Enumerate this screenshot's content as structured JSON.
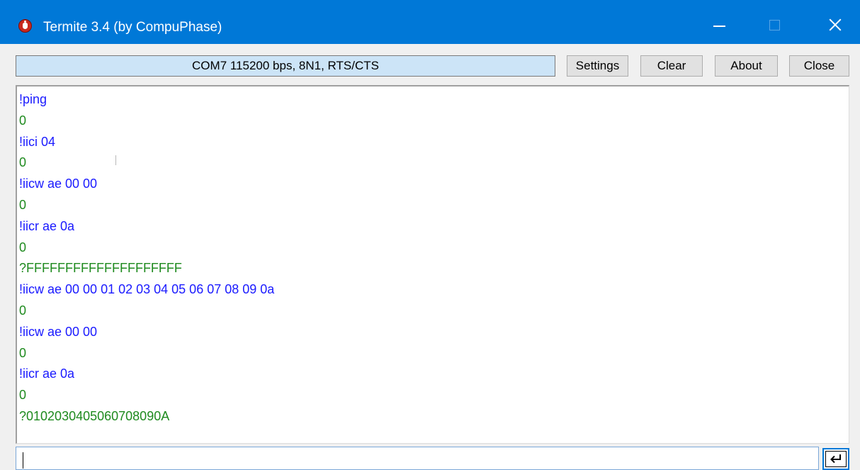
{
  "window": {
    "title": "Termite 3.4 (by CompuPhase)"
  },
  "toolbar": {
    "status": "COM7 115200 bps, 8N1, RTS/CTS",
    "settings_label": "Settings",
    "clear_label": "Clear",
    "about_label": "About",
    "close_label": "Close"
  },
  "terminal": {
    "lines": [
      {
        "text": "!ping",
        "kind": "tx"
      },
      {
        "text": "0",
        "kind": "rx"
      },
      {
        "text": "!iici 04",
        "kind": "tx"
      },
      {
        "text": "0",
        "kind": "rx"
      },
      {
        "text": "!iicw ae 00 00",
        "kind": "tx"
      },
      {
        "text": "0",
        "kind": "rx"
      },
      {
        "text": "!iicr ae 0a",
        "kind": "tx"
      },
      {
        "text": "0",
        "kind": "rx"
      },
      {
        "text": "?FFFFFFFFFFFFFFFFFFFF",
        "kind": "rx"
      },
      {
        "text": "!iicw ae 00 00 01 02 03 04 05 06 07 08 09 0a",
        "kind": "tx"
      },
      {
        "text": "0",
        "kind": "rx"
      },
      {
        "text": "!iicw ae 00 00",
        "kind": "tx"
      },
      {
        "text": "0",
        "kind": "rx"
      },
      {
        "text": "!iicr ae 0a",
        "kind": "tx"
      },
      {
        "text": "0",
        "kind": "rx"
      },
      {
        "text": "?0102030405060708090A",
        "kind": "rx"
      }
    ]
  },
  "input": {
    "value": ""
  },
  "colors": {
    "titlebar": "#0078d7",
    "status_background": "#cce4f7",
    "sent_text": "#1a1aff",
    "received_text": "#1e8a1e"
  },
  "icons": {
    "app": "termite-bug-icon",
    "send": "enter-return-icon"
  }
}
